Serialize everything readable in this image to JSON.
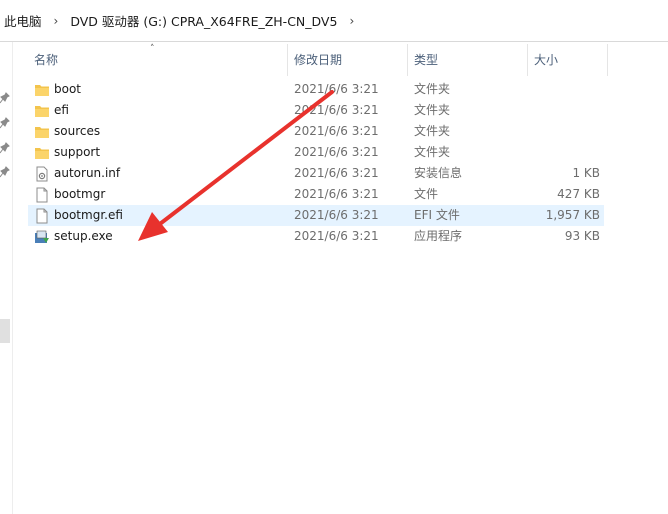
{
  "breadcrumb": [
    {
      "label": "此电脑"
    },
    {
      "label": "DVD 驱动器 (G:) CPRA_X64FRE_ZH-CN_DV5"
    }
  ],
  "columns": {
    "name": "名称",
    "date": "修改日期",
    "type": "类型",
    "size": "大小"
  },
  "files": [
    {
      "name": "boot",
      "date": "2021/6/6 3:21",
      "type": "文件夹",
      "size": "",
      "icon": "folder-icon"
    },
    {
      "name": "efi",
      "date": "2021/6/6 3:21",
      "type": "文件夹",
      "size": "",
      "icon": "folder-icon"
    },
    {
      "name": "sources",
      "date": "2021/6/6 3:21",
      "type": "文件夹",
      "size": "",
      "icon": "folder-icon"
    },
    {
      "name": "support",
      "date": "2021/6/6 3:21",
      "type": "文件夹",
      "size": "",
      "icon": "folder-icon"
    },
    {
      "name": "autorun.inf",
      "date": "2021/6/6 3:21",
      "type": "安装信息",
      "size": "1 KB",
      "icon": "setup-info-file-icon"
    },
    {
      "name": "bootmgr",
      "date": "2021/6/6 3:21",
      "type": "文件",
      "size": "427 KB",
      "icon": "blank-file-icon"
    },
    {
      "name": "bootmgr.efi",
      "date": "2021/6/6 3:21",
      "type": "EFI 文件",
      "size": "1,957 KB",
      "icon": "blank-file-icon",
      "selected": true
    },
    {
      "name": "setup.exe",
      "date": "2021/6/6 3:21",
      "type": "应用程序",
      "size": "93 KB",
      "icon": "setup-exe-icon"
    }
  ],
  "colors": {
    "accent_arrow": "#e8322d",
    "selection": "#e5f3ff",
    "header_text": "#4c607a",
    "folder": "#f3c44d"
  }
}
